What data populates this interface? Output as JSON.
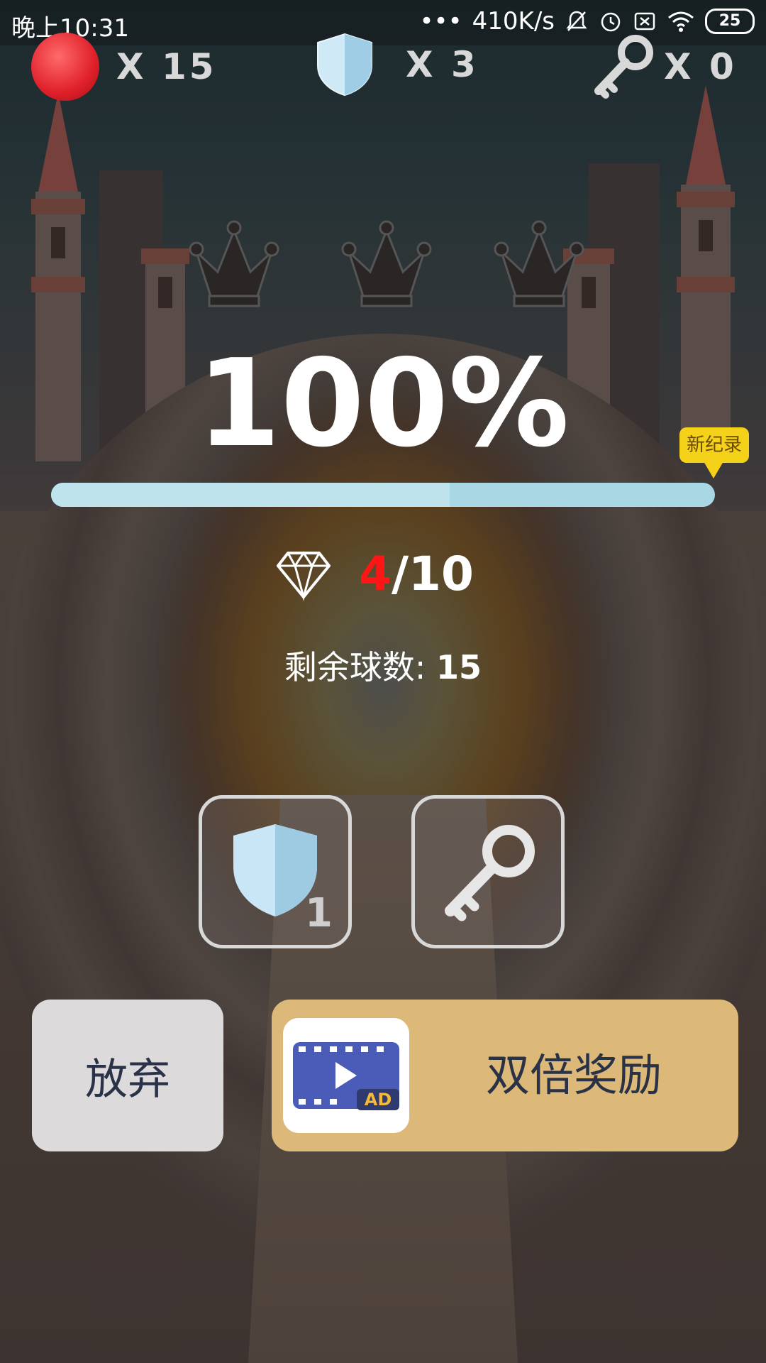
{
  "status_bar": {
    "time": "晚上10:31",
    "dots": "•••",
    "network_speed": "410K/s",
    "battery": "25"
  },
  "hud": {
    "balls": "X 15",
    "shields": "X 3",
    "keys": "X 0"
  },
  "crowns_earned": 0,
  "crowns_total": 3,
  "result": {
    "percent": "100%",
    "record_badge": "新纪录",
    "progress_fraction": 0.6
  },
  "gems": {
    "current": "4",
    "separator": "/",
    "total": "10"
  },
  "remaining": {
    "label": "剩余球数:",
    "value": "15"
  },
  "items": {
    "shield_count": "1"
  },
  "buttons": {
    "give_up": "放弃",
    "double_reward": "双倍奖励",
    "ad_label": "AD"
  },
  "colors": {
    "progress_track": "#a9d8e4",
    "gem_current": "#ff1515",
    "double_button": "#dcb978",
    "giveup_button": "#dcdadb",
    "record_badge": "#f5d21a"
  }
}
